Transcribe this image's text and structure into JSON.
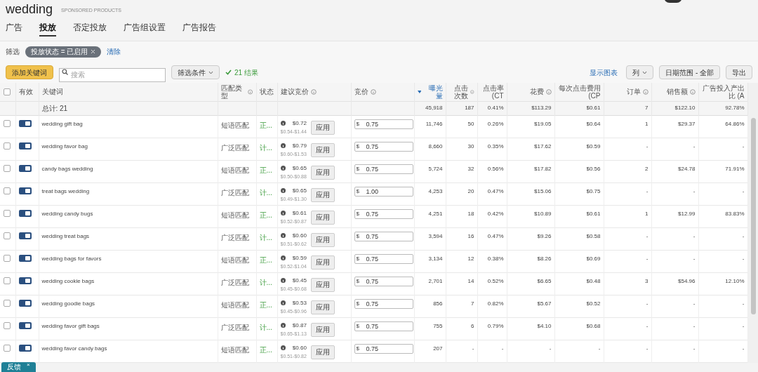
{
  "header": {
    "title": "wedding",
    "subtitle": "SPONSORED PRODUCTS"
  },
  "tabs": [
    {
      "label": "广告",
      "selected": false
    },
    {
      "label": "投放",
      "selected": true
    },
    {
      "label": "否定投放",
      "selected": false
    },
    {
      "label": "广告组设置",
      "selected": false
    },
    {
      "label": "广告报告",
      "selected": false
    }
  ],
  "filter": {
    "label": "筛选",
    "chip": "投放状态 = 已启用",
    "clear": "清除"
  },
  "toolbar": {
    "add_button": "添加关键词",
    "search": {
      "placeholder": "搜索"
    },
    "filter_dropdown": "筛选条件",
    "result": "21 结果",
    "show_chart": "显示图表",
    "columns_button": "列",
    "date_range": "日期范围 - 全部",
    "export": "导出"
  },
  "table": {
    "select_all_checked": false,
    "columns": [
      {
        "label": "有效",
        "info": false,
        "sorted": false
      },
      {
        "label": "关键词",
        "info": false,
        "sorted": false
      },
      {
        "label": "匹配类型",
        "info": true,
        "sorted": false
      },
      {
        "label": "状态",
        "info": false,
        "sorted": false
      },
      {
        "label": "建议竞价",
        "info": true,
        "sorted": false
      },
      {
        "label": "竞价",
        "info": true,
        "sorted": false
      },
      {
        "label": "曝光量",
        "info": false,
        "sorted": true
      },
      {
        "label": "点击次数",
        "info": true,
        "sorted": false
      },
      {
        "label": "点击率 (CT",
        "info": false,
        "sorted": false
      },
      {
        "label": "花费",
        "info": true,
        "sorted": false
      },
      {
        "label": "每次点击费用 (CP",
        "info": false,
        "sorted": false
      },
      {
        "label": "订单",
        "info": true,
        "sorted": false
      },
      {
        "label": "销售额",
        "info": true,
        "sorted": false
      },
      {
        "label": "广告投入产出比 (A",
        "info": false,
        "sorted": false
      }
    ],
    "total": {
      "label": "总计: 21",
      "impressions": "45,918",
      "clicks": "187",
      "ctr": "0.41%",
      "spend": "$113.29",
      "cpc": "$0.61",
      "orders": "7",
      "sales": "$122.10",
      "acos": "92.78%"
    },
    "rows": [
      {
        "checked": false,
        "enabled": true,
        "keyword": "wedding gift bag",
        "match_type": "短语匹配",
        "status": "正...",
        "suggested_bid": "$0.72",
        "bid_range": "$0.54-$1.44",
        "apply": "应用",
        "currency": "$",
        "bid": "0.75",
        "impressions": "11,746",
        "clicks": "50",
        "ctr": "0.26%",
        "spend": "$19.05",
        "cpc": "$0.64",
        "orders": "1",
        "sales": "$29.37",
        "acos": "64.86%"
      },
      {
        "checked": false,
        "enabled": true,
        "keyword": "wedding favor bag",
        "match_type": "广泛匹配",
        "status": "计...",
        "suggested_bid": "$0.79",
        "bid_range": "$0.60-$1.53",
        "apply": "应用",
        "currency": "$",
        "bid": "0.75",
        "impressions": "8,660",
        "clicks": "30",
        "ctr": "0.35%",
        "spend": "$17.62",
        "cpc": "$0.59",
        "orders": "-",
        "sales": "-",
        "acos": "-"
      },
      {
        "checked": false,
        "enabled": true,
        "keyword": "candy bags wedding",
        "match_type": "短语匹配",
        "status": "正...",
        "suggested_bid": "$0.65",
        "bid_range": "$0.50-$0.88",
        "apply": "应用",
        "currency": "$",
        "bid": "0.75",
        "impressions": "5,724",
        "clicks": "32",
        "ctr": "0.56%",
        "spend": "$17.82",
        "cpc": "$0.56",
        "orders": "2",
        "sales": "$24.78",
        "acos": "71.91%"
      },
      {
        "checked": false,
        "enabled": true,
        "keyword": "treat bags wedding",
        "match_type": "广泛匹配",
        "status": "计...",
        "suggested_bid": "$0.65",
        "bid_range": "$0.49-$1.30",
        "apply": "应用",
        "currency": "$",
        "bid": "1.00",
        "impressions": "4,253",
        "clicks": "20",
        "ctr": "0.47%",
        "spend": "$15.06",
        "cpc": "$0.75",
        "orders": "-",
        "sales": "-",
        "acos": "-"
      },
      {
        "checked": false,
        "enabled": true,
        "keyword": "wedding candy bugs",
        "match_type": "短语匹配",
        "status": "正...",
        "suggested_bid": "$0.61",
        "bid_range": "$0.52-$0.87",
        "apply": "应用",
        "currency": "$",
        "bid": "0.75",
        "impressions": "4,251",
        "clicks": "18",
        "ctr": "0.42%",
        "spend": "$10.89",
        "cpc": "$0.61",
        "orders": "1",
        "sales": "$12.99",
        "acos": "83.83%"
      },
      {
        "checked": false,
        "enabled": true,
        "keyword": "wedding treat bags",
        "match_type": "广泛匹配",
        "status": "计...",
        "suggested_bid": "$0.60",
        "bid_range": "$0.51-$0.62",
        "apply": "应用",
        "currency": "$",
        "bid": "0.75",
        "impressions": "3,594",
        "clicks": "16",
        "ctr": "0.47%",
        "spend": "$9.26",
        "cpc": "$0.58",
        "orders": "-",
        "sales": "-",
        "acos": "-"
      },
      {
        "checked": false,
        "enabled": true,
        "keyword": "wedding bags for favors",
        "match_type": "短语匹配",
        "status": "正...",
        "suggested_bid": "$0.59",
        "bid_range": "$0.52-$1.04",
        "apply": "应用",
        "currency": "$",
        "bid": "0.75",
        "impressions": "3,134",
        "clicks": "12",
        "ctr": "0.38%",
        "spend": "$8.26",
        "cpc": "$0.69",
        "orders": "-",
        "sales": "-",
        "acos": "-"
      },
      {
        "checked": false,
        "enabled": true,
        "keyword": "wedding cookie bags",
        "match_type": "广泛匹配",
        "status": "计...",
        "suggested_bid": "$0.45",
        "bid_range": "$0.45-$0.68",
        "apply": "应用",
        "currency": "$",
        "bid": "0.75",
        "impressions": "2,701",
        "clicks": "14",
        "ctr": "0.52%",
        "spend": "$6.65",
        "cpc": "$0.48",
        "orders": "3",
        "sales": "$54.96",
        "acos": "12.10%"
      },
      {
        "checked": false,
        "enabled": true,
        "keyword": "wedding goodie bags",
        "match_type": "短语匹配",
        "status": "正...",
        "suggested_bid": "$0.53",
        "bid_range": "$0.45-$0.96",
        "apply": "应用",
        "currency": "$",
        "bid": "0.75",
        "impressions": "856",
        "clicks": "7",
        "ctr": "0.82%",
        "spend": "$5.67",
        "cpc": "$0.52",
        "orders": "-",
        "sales": "-",
        "acos": "-"
      },
      {
        "checked": false,
        "enabled": true,
        "keyword": "wedding favor gift bags",
        "match_type": "广泛匹配",
        "status": "计...",
        "suggested_bid": "$0.87",
        "bid_range": "$0.65-$1.13",
        "apply": "应用",
        "currency": "$",
        "bid": "0.75",
        "impressions": "755",
        "clicks": "6",
        "ctr": "0.79%",
        "spend": "$4.10",
        "cpc": "$0.68",
        "orders": "-",
        "sales": "-",
        "acos": "-"
      },
      {
        "checked": false,
        "enabled": true,
        "keyword": "wedding favor candy bags",
        "match_type": "短语匹配",
        "status": "正...",
        "suggested_bid": "$0.60",
        "bid_range": "$0.51-$0.82",
        "apply": "应用",
        "currency": "$",
        "bid": "0.75",
        "impressions": "207",
        "clicks": "-",
        "ctr": "-",
        "spend": "-",
        "cpc": "-",
        "orders": "-",
        "sales": "-",
        "acos": "-"
      }
    ]
  },
  "feedback": {
    "label": "反馈",
    "close": "×"
  }
}
